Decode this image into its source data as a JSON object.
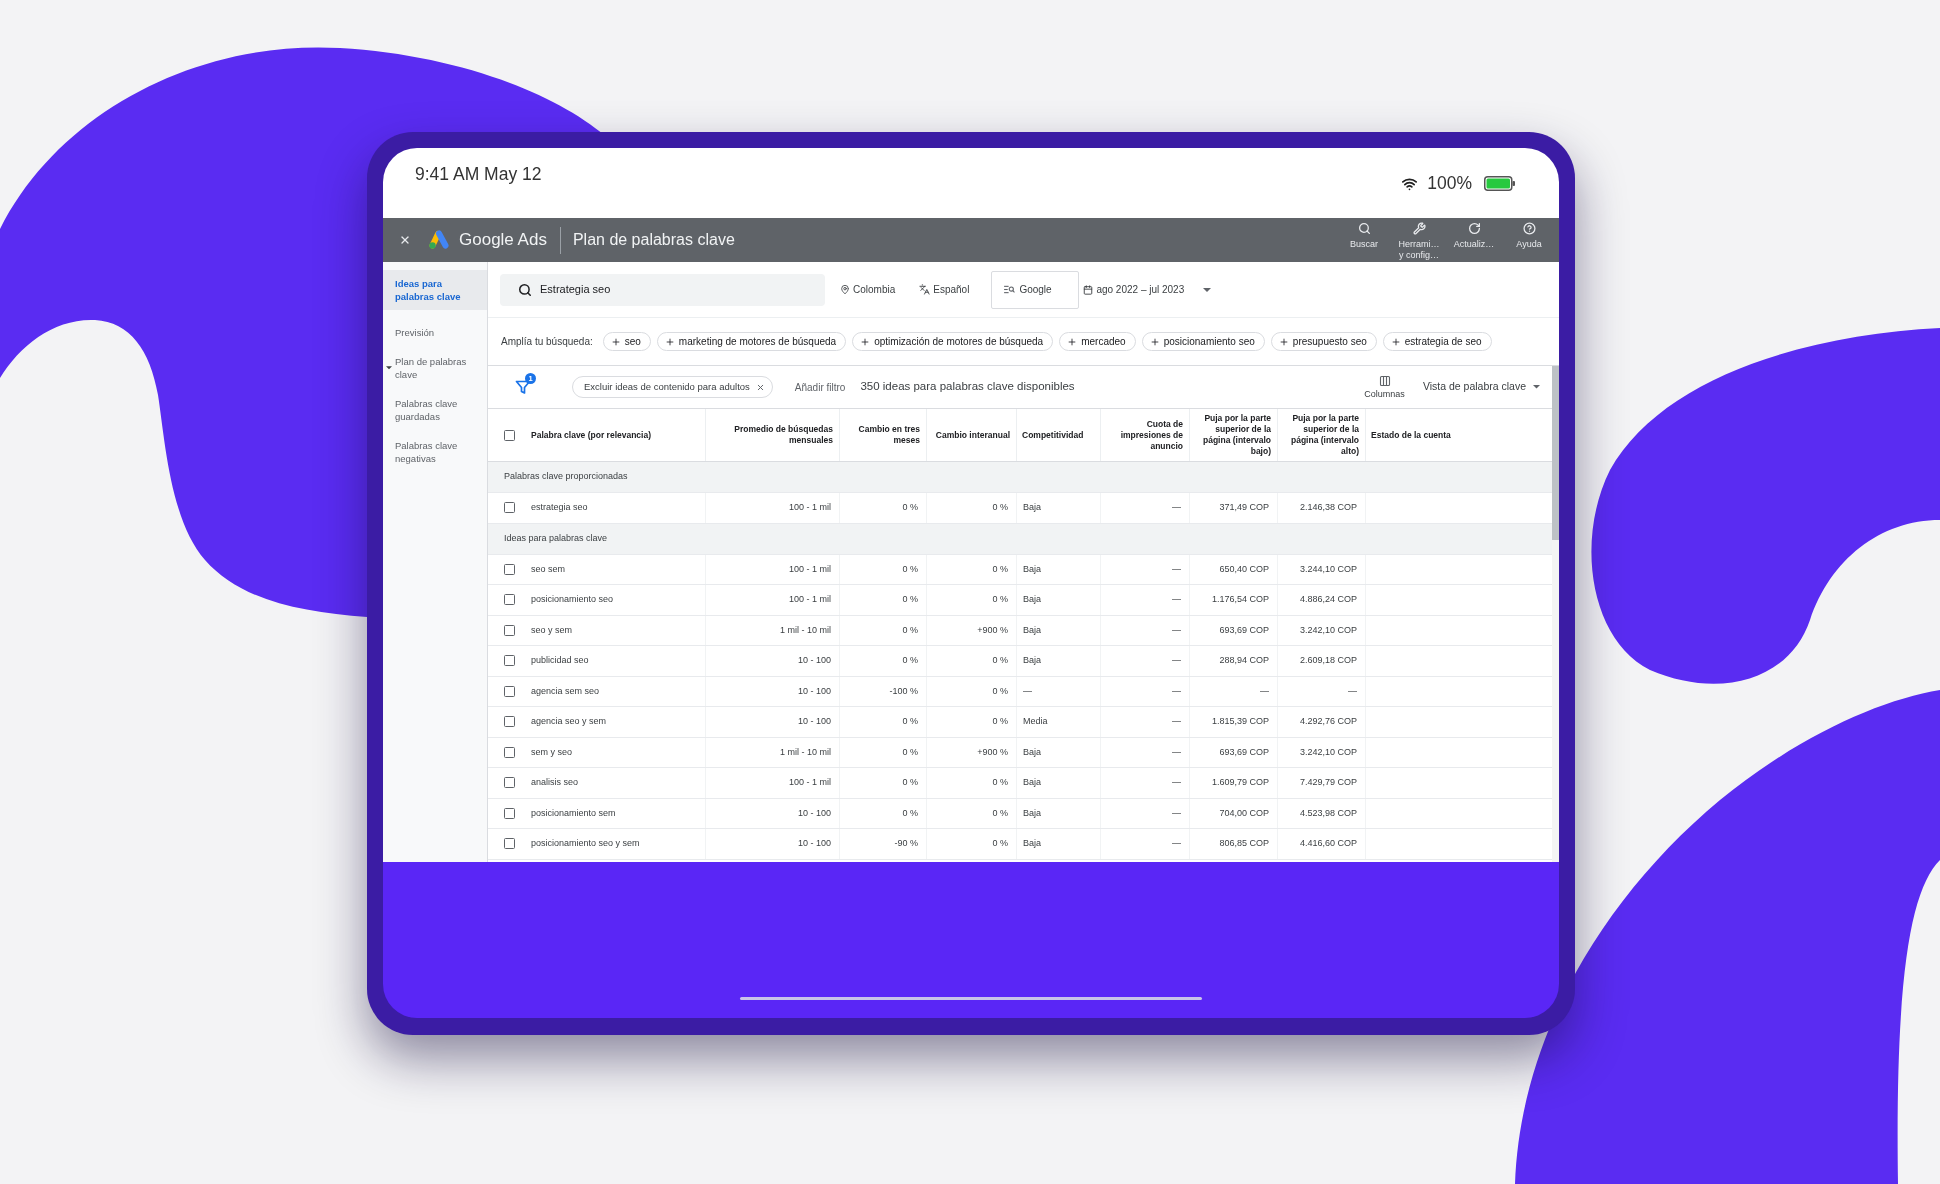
{
  "status_bar": {
    "time": "9:41 AM May 12",
    "battery": "100%"
  },
  "app_bar": {
    "product": "Google Ads",
    "title": "Plan de palabras clave",
    "actions": [
      {
        "kind": "search",
        "label": "Buscar"
      },
      {
        "kind": "tools",
        "label": "Herrami…\ny config…"
      },
      {
        "kind": "refresh",
        "label": "Actualiz…"
      },
      {
        "kind": "help",
        "label": "Ayuda"
      }
    ]
  },
  "sidebar": {
    "items": [
      {
        "kind": "link",
        "label": "Ideas para palabras clave",
        "selected": true
      },
      {
        "kind": "link",
        "label": "Previsión",
        "selected": false
      },
      {
        "kind": "group",
        "label": "Plan de palabras clave",
        "selected": false
      },
      {
        "kind": "link",
        "label": "Palabras clave guardadas",
        "selected": false
      },
      {
        "kind": "link",
        "label": "Palabras clave negativas",
        "selected": false
      }
    ]
  },
  "search": {
    "value": "Estrategia seo",
    "location": "Colombia",
    "language": "Español",
    "network": "Google",
    "date_range": "ago 2022 – jul 2023"
  },
  "broaden": {
    "label": "Amplía tu búsqueda:",
    "chips": [
      "seo",
      "marketing de motores de búsqueda",
      "optimización de motores de búsqueda",
      "mercadeo",
      "posicionamiento seo",
      "presupuesto seo",
      "estrategia de seo"
    ]
  },
  "filter_bar": {
    "badge": "1",
    "chips": [
      "Excluir ideas de contenido para adultos"
    ],
    "add_filter": "Añadir filtro",
    "summary": "350 ideas para palabras clave disponibles",
    "columns": "Columnas",
    "view": "Vista de palabra clave"
  },
  "table": {
    "select_all": {
      "checked": false
    },
    "columns": [
      "Palabra clave (por relevancia)",
      "Promedio de búsquedas mensuales",
      "Cambio en tres meses",
      "Cambio interanual",
      "Competitividad",
      "Cuota de impresiones de anuncio",
      "Puja por la parte superior de la página (intervalo bajo)",
      "Puja por la parte superior de la página (intervalo alto)",
      "Estado de la cuenta"
    ],
    "groups": [
      {
        "title": "Palabras clave proporcionadas",
        "rows": [
          {
            "checked": false,
            "cells": [
              "estrategia seo",
              "100 - 1 mil",
              "0 %",
              "0 %",
              "Baja",
              "—",
              "371,49 COP",
              "2.146,38 COP"
            ]
          }
        ]
      },
      {
        "title": "Ideas para palabras clave",
        "rows": [
          {
            "checked": false,
            "cells": [
              "seo sem",
              "100 - 1 mil",
              "0 %",
              "0 %",
              "Baja",
              "—",
              "650,40 COP",
              "3.244,10 COP"
            ]
          },
          {
            "checked": false,
            "cells": [
              "posicionamiento seo",
              "100 - 1 mil",
              "0 %",
              "0 %",
              "Baja",
              "—",
              "1.176,54 COP",
              "4.886,24 COP"
            ]
          },
          {
            "checked": false,
            "cells": [
              "seo y sem",
              "1 mil - 10 mil",
              "0 %",
              "+900 %",
              "Baja",
              "—",
              "693,69 COP",
              "3.242,10 COP"
            ]
          },
          {
            "checked": false,
            "cells": [
              "publicidad seo",
              "10 - 100",
              "0 %",
              "0 %",
              "Baja",
              "—",
              "288,94 COP",
              "2.609,18 COP"
            ]
          },
          {
            "checked": false,
            "cells": [
              "agencia sem seo",
              "10 - 100",
              "-100 %",
              "0 %",
              "—",
              "—",
              "—",
              "—"
            ]
          },
          {
            "checked": false,
            "cells": [
              "agencia seo y sem",
              "10 - 100",
              "0 %",
              "0 %",
              "Media",
              "—",
              "1.815,39 COP",
              "4.292,76 COP"
            ]
          },
          {
            "checked": false,
            "cells": [
              "sem y seo",
              "1 mil - 10 mil",
              "0 %",
              "+900 %",
              "Baja",
              "—",
              "693,69 COP",
              "3.242,10 COP"
            ]
          },
          {
            "checked": false,
            "cells": [
              "analisis seo",
              "100 - 1 mil",
              "0 %",
              "0 %",
              "Baja",
              "—",
              "1.609,79 COP",
              "7.429,79 COP"
            ]
          },
          {
            "checked": false,
            "cells": [
              "posicionamiento sem",
              "10 - 100",
              "0 %",
              "0 %",
              "Baja",
              "—",
              "704,00 COP",
              "4.523,98 COP"
            ]
          },
          {
            "checked": false,
            "cells": [
              "posicionamiento seo y sem",
              "10 - 100",
              "-90 %",
              "0 %",
              "Baja",
              "—",
              "806,85 COP",
              "4.416,60 COP"
            ]
          }
        ]
      }
    ]
  }
}
